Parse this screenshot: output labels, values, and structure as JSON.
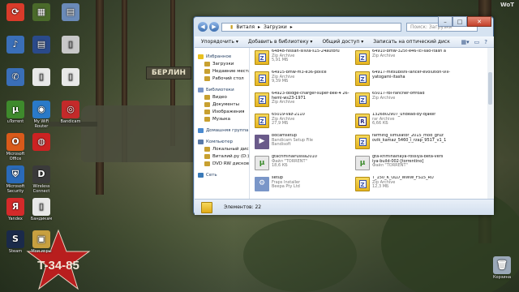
{
  "desktop": {
    "sign_text": "БЕРЛИН",
    "game_logo": "WoT",
    "star_text": "T-34-85",
    "icons": [
      {
        "label": "",
        "color": "#d93b2a",
        "glyph": "⟳"
      },
      {
        "label": "",
        "color": "#3a6fb8",
        "glyph": "♪"
      },
      {
        "label": "",
        "color": "#3a6fb8",
        "glyph": "✆"
      },
      {
        "label": "uTorrent",
        "color": "#3e8a2c",
        "glyph": "µ"
      },
      {
        "label": "Microsoft Office",
        "color": "#d95a1a",
        "glyph": "O"
      },
      {
        "label": "Microsoft Security",
        "color": "#2a6ab8",
        "glyph": "⛨"
      },
      {
        "label": "Yandex",
        "color": "#d42a2a",
        "glyph": "Я"
      },
      {
        "label": "Steam",
        "color": "#1a2a4a",
        "glyph": "S"
      },
      {
        "label": "",
        "color": "#4a6a2a",
        "glyph": "▦"
      },
      {
        "label": "",
        "color": "#2a4a8a",
        "glyph": "▤"
      },
      {
        "label": "",
        "color": "#e8e8e8",
        "glyph": "▯"
      },
      {
        "label": "My WiFi Router",
        "color": "#2a7ac8",
        "glyph": "◉"
      },
      {
        "label": "",
        "color": "#cc2222",
        "glyph": "◍"
      },
      {
        "label": "Wireless Connect",
        "color": "#3a3a3a",
        "glyph": "D"
      },
      {
        "label": "Бандикам",
        "color": "#e8e8e8",
        "glyph": "▯"
      },
      {
        "label": "Мои игры",
        "color": "#c8a040",
        "glyph": "▣"
      },
      {
        "label": "",
        "color": "#6a8ab8",
        "glyph": "▤"
      },
      {
        "label": "",
        "color": "#c8c8c8",
        "glyph": "▯"
      },
      {
        "label": "",
        "color": "#e8e8e8",
        "glyph": "▯"
      },
      {
        "label": "Bandicam",
        "color": "#c42a2a",
        "glyph": "◎"
      }
    ],
    "recycle_label": "Корзина"
  },
  "window": {
    "breadcrumb": [
      "Виталя",
      "Загрузки"
    ],
    "search_placeholder": "Поиск: Загрузки",
    "toolbar": {
      "organize": "Упорядочить ▾",
      "add_library": "Добавить в библиотеку ▾",
      "share": "Общий доступ ▾",
      "burn": "Записать на оптический диск",
      "new_folder": "Новая папка"
    },
    "nav": {
      "favorites": "Избранное",
      "favorites_items": [
        "Загрузки",
        "Недавние места",
        "Рабочий стол"
      ],
      "libraries": "Библиотеки",
      "libraries_items": [
        "Видео",
        "Документы",
        "Изображения",
        "Музыка"
      ],
      "homegroup": "Домашняя группа",
      "computer": "Компьютер",
      "computer_items": [
        "Локальный диск",
        "Виталий.ру (D:)",
        "DVD RW дисковод"
      ],
      "network": "Сеть"
    },
    "files": [
      {
        "name": "64848-nissan-silvia-s15-24autoru",
        "meta": "Zip Archive",
        "size": "5,91 МБ",
        "type": "zip"
      },
      {
        "name": "64910-bmw-325t-e46-lci-sao-itash a",
        "meta": "Zip Archive",
        "size": "",
        "type": "zip"
      },
      {
        "name": "64915-bmw-m3-e36-police",
        "meta": "Zip Archive",
        "size": "9,39 МБ",
        "type": "zip"
      },
      {
        "name": "64917-mitsubishi-lancer-evolution-viii-yatogami-itasha",
        "meta": "",
        "size": "",
        "type": "zip"
      },
      {
        "name": "64923-dodge-charger-super-bee-4 26-hemi-ws23-1971",
        "meta": "Zip Archive",
        "size": "",
        "type": "zip"
      },
      {
        "name": "65017-fbi-rancher-offroad",
        "meta": "Zip Archive",
        "size": "",
        "type": "zip"
      },
      {
        "name": "65019-vaz-2110",
        "meta": "Zip Archive",
        "size": "27,9 МБ",
        "type": "zip"
      },
      {
        "name": "1326802907_undead-by-djaker",
        "meta": "rar Archive",
        "size": "6,66 КБ",
        "type": "rar"
      },
      {
        "name": "bdcamsetup",
        "meta": "Bandicam Setup File",
        "size": "Bandisoft",
        "type": "app"
      },
      {
        "name": "farming_simulator_2015_mod_gruz ovik_kamaz_5460_i_rzap_9517_v1_1",
        "meta": "",
        "size": "",
        "type": "zip"
      },
      {
        "name": "gtacriminalrussia2010",
        "meta": "Файл \"TORRENT\"",
        "size": "18,6 КБ",
        "type": "torrent"
      },
      {
        "name": "gta-kriminalnaya-rossiya-beta-vers iya-build-002-[torrentino]",
        "meta": "Файл \"TORRENT\"",
        "size": "",
        "type": "torrent"
      },
      {
        "name": "setup",
        "meta": "Fraps Installer",
        "size": "Beepa Pty Ltd",
        "type": "setup"
      },
      {
        "name": "T_150_K_OLD_WWW_FS15_RU",
        "meta": "Zip Archive",
        "size": "12,3 МБ",
        "type": "zip"
      }
    ],
    "status": "Элементов: 22"
  }
}
